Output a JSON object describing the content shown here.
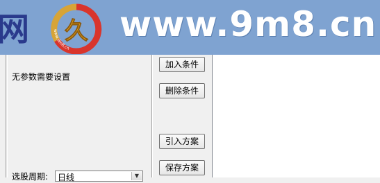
{
  "watermark": {
    "char": "网",
    "logo_text": "www.9m8.cn",
    "logo_glyph": "久",
    "url": "www.9m8.cn"
  },
  "panel": {
    "no_param_text": "无参数需要设置",
    "period_label": "选股周期:",
    "period_value": "日线"
  },
  "buttons": {
    "add_condition": "加入条件",
    "delete_condition": "删除条件",
    "import_plan": "引入方案",
    "save_plan": "保存方案"
  },
  "colors": {
    "banner": "#7fa3d1",
    "logo_ring": "#d9352c",
    "logo_gold": "#e6a51c"
  }
}
